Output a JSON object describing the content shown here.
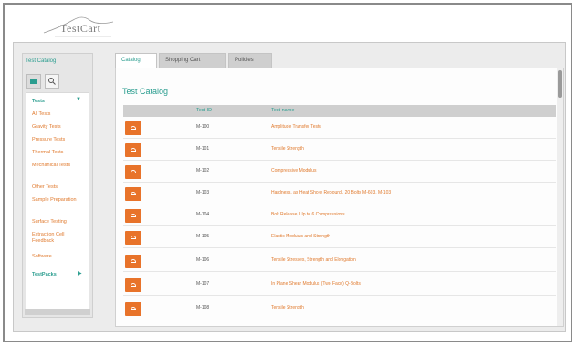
{
  "app": {
    "logo_text": "TestCart"
  },
  "sidebar": {
    "title": "Test Catalog",
    "section": "Tests",
    "items": [
      {
        "label": "All Tests"
      },
      {
        "label": "Gravity Tests"
      },
      {
        "label": "Pressure Tests"
      },
      {
        "label": "Thermal Tests"
      },
      {
        "label": "Mechanical Tests"
      },
      {
        "label": "Other Tests"
      },
      {
        "label": "Sample Preparation"
      },
      {
        "label": "Surface Testing"
      },
      {
        "label": "Extraction Cell Feedback"
      },
      {
        "label": "Software"
      }
    ],
    "footer_item": "TestPacks"
  },
  "tabs": [
    {
      "label": "Catalog",
      "active": true
    },
    {
      "label": "Shopping Cart",
      "active": false
    },
    {
      "label": "Policies",
      "active": false
    }
  ],
  "catalog": {
    "title": "Test Catalog",
    "columns": {
      "id": "Test ID",
      "name": "Test name"
    },
    "rows": [
      {
        "id": "M-100",
        "name": "Amplitude Transfer Tests"
      },
      {
        "id": "M-101",
        "name": "Tensile Strength"
      },
      {
        "id": "M-102",
        "name": "Compressive Modulus"
      },
      {
        "id": "M-103",
        "name": "Hardness, as Heat Shore Rebound, 20 Bolts M-603, M-103"
      },
      {
        "id": "M-104",
        "name": "Bolt Release, Up to 6 Compressions"
      },
      {
        "id": "M-105",
        "name": "Elastic Modulus and Strength"
      },
      {
        "id": "M-106",
        "name": "Tensile Stresses, Strength and Elongation"
      },
      {
        "id": "M-107",
        "name": "In Plane Shear Modulus (Two Face) Q-Bolts"
      },
      {
        "id": "M-108",
        "name": "Tensile Strength"
      }
    ]
  },
  "colors": {
    "accent": "#2a9d8f",
    "action": "#e8732a",
    "link": "#e07a2e"
  }
}
